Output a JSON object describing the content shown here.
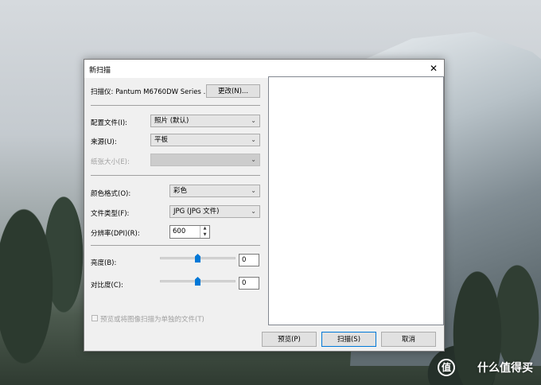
{
  "dialog": {
    "title": "新扫描",
    "close_glyph": "✕",
    "scanner_label": "扫描仪: Pantum M6760DW Series ...",
    "change_button": "更改(N)...",
    "profile": {
      "label": "配置文件(I):",
      "value": "照片 (默认)"
    },
    "source": {
      "label": "来源(U):",
      "value": "平板"
    },
    "paper_size": {
      "label": "纸张大小(E):",
      "value": ""
    },
    "color_format": {
      "label": "颜色格式(O):",
      "value": "彩色"
    },
    "file_type": {
      "label": "文件类型(F):",
      "value": "JPG (JPG 文件)"
    },
    "resolution": {
      "label": "分辨率(DPI)(R):",
      "value": "600"
    },
    "brightness": {
      "label": "亮度(B):",
      "value": "0",
      "level": 0.5
    },
    "contrast": {
      "label": "对比度(C):",
      "value": "0",
      "level": 0.5
    },
    "separate_files_checkbox": "预览或将图像扫描为单独的文件(T)",
    "buttons": {
      "preview": "预览(P)",
      "scan": "扫描(S)",
      "cancel": "取消"
    }
  },
  "watermark": {
    "icon_glyph": "值",
    "text": "什么值得买"
  }
}
